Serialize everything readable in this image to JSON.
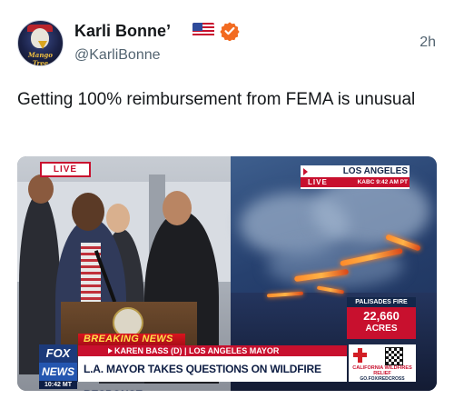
{
  "author": {
    "display_name": "Karli Bonne’",
    "handle": "@KarliBonne",
    "avatar_text": "Mango Tree",
    "flag": "us-flag-icon",
    "verified": "verified-badge-icon"
  },
  "post": {
    "time": "2h",
    "text": "Getting 100% reimbursement from FEMA is unusual"
  },
  "video": {
    "live_badge": "LIVE",
    "location": "LOS ANGELES",
    "location_live": "LIVE",
    "location_meta": "KABC  9:42 AM PT",
    "fire_label": "PALISADES FIRE",
    "fire_value": "22,660",
    "fire_unit": "ACRES",
    "breaking": "BREAKING NEWS",
    "subline": "KAREN BASS (D) | LOS ANGELES MAYOR",
    "headline": "L.A. MAYOR TAKES QUESTIONS ON WILDFIRE RESPONSE",
    "network_top": "FOX",
    "network_bottom": "NEWS",
    "network_time": "10:42 MT",
    "promo_line1": "CALIFORNIA WILDFIRES RELIEF",
    "promo_line2": "GO.FOX/REDCROSS"
  },
  "colors": {
    "accent_red": "#c8102e",
    "fox_blue": "#1c3a7a",
    "verified_orange": "#f26b21"
  }
}
